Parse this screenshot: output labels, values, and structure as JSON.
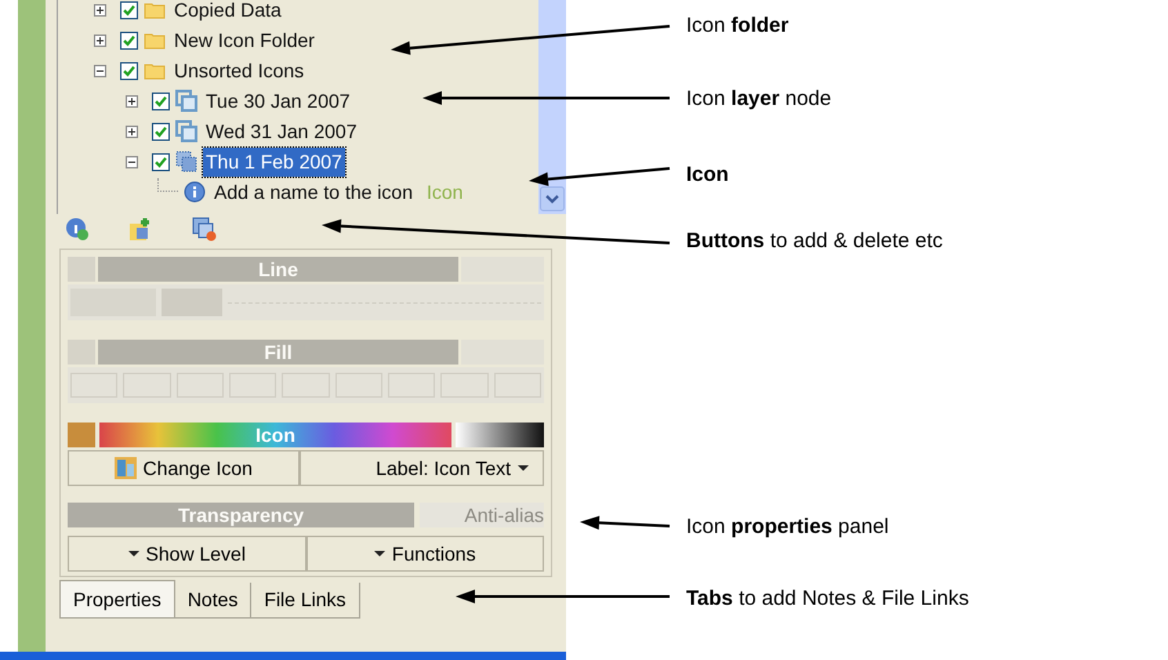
{
  "tree": [
    {
      "label": "Copied Data",
      "kind": "folder",
      "checked": true,
      "expanded": false,
      "selected": false
    },
    {
      "label": "New Icon Folder",
      "kind": "folder",
      "checked": true,
      "expanded": false,
      "selected": false
    },
    {
      "label": "Unsorted Icons",
      "kind": "folder",
      "checked": true,
      "expanded": true,
      "selected": false,
      "children": [
        {
          "label": "Tue 30 Jan 2007",
          "kind": "layer",
          "checked": true,
          "expanded": false,
          "selected": false
        },
        {
          "label": "Wed 31 Jan 2007",
          "kind": "layer",
          "checked": true,
          "expanded": false,
          "selected": false
        },
        {
          "label": "Thu 1 Feb 2007",
          "kind": "icon",
          "checked": true,
          "expanded": true,
          "selected": true,
          "children": [
            {
              "label": "Add a name to the icon",
              "kind": "info",
              "suffix": "Icon",
              "selected": false
            }
          ]
        }
      ]
    }
  ],
  "properties": {
    "line": {
      "title": "Line",
      "disabled": true
    },
    "fill": {
      "title": "Fill",
      "disabled": true
    },
    "color_bar": {
      "title": "Icon"
    },
    "change_icon": "Change Icon",
    "label_button": "Label: Icon Text",
    "transparency": {
      "title": "Transparency",
      "anti_alias": "Anti-alias",
      "disabled": true
    },
    "show_level": "Show Level",
    "functions": "Functions"
  },
  "tabs": [
    {
      "label": "Properties",
      "selected": true
    },
    {
      "label": "Notes",
      "selected": false
    },
    {
      "label": "File Links",
      "selected": false
    }
  ],
  "annotations": [
    {
      "text": "Icon **folder**"
    },
    {
      "text": "Icon **layer** node"
    },
    {
      "text": "**Icon**"
    },
    {
      "text": "**Buttons** to add & delete etc"
    },
    {
      "text": "Icon **properties** panel"
    },
    {
      "text": "**Tabs** to add Notes & File Links"
    }
  ]
}
